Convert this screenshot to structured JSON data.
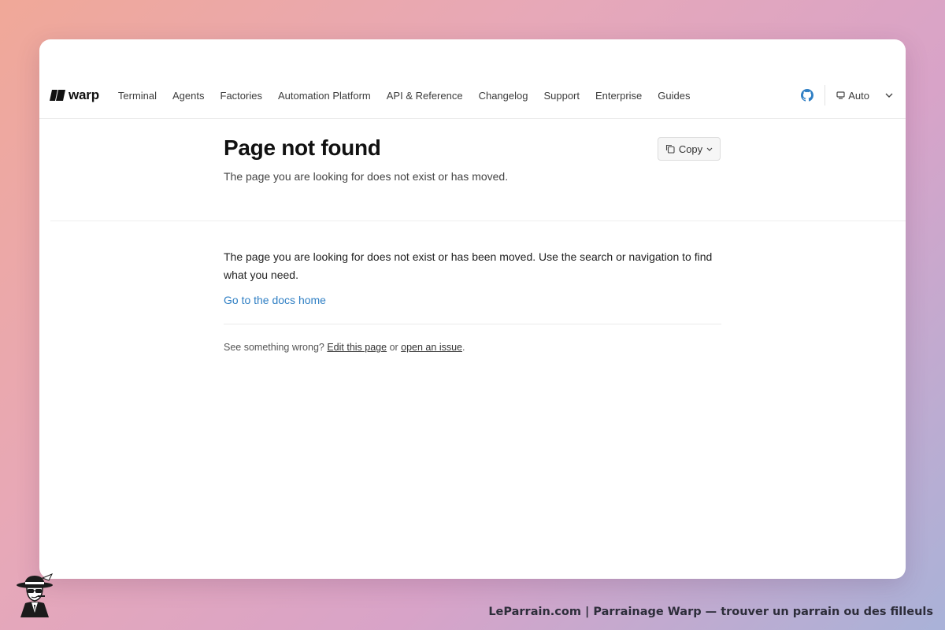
{
  "brand": {
    "logo_text": "warp"
  },
  "nav": {
    "links": [
      "Terminal",
      "Agents",
      "Factories",
      "Automation Platform",
      "API & Reference",
      "Changelog",
      "Support",
      "Enterprise",
      "Guides"
    ],
    "github_icon": "github-icon",
    "theme_icon": "monitor-icon",
    "theme_value": "Auto",
    "theme_chevron_icon": "chevron-down-icon"
  },
  "header": {
    "title": "Page not found",
    "subtitle": "The page you are looking for does not exist or has moved.",
    "copy_label": "Copy",
    "copy_icon": "copy-icon"
  },
  "main": {
    "message": "The page you are looking for does not exist or has been moved. Use the search or navigation to find what you need.",
    "docs_link": "Go to the docs home",
    "feedback_prefix": "See something wrong? ",
    "edit_link": "Edit this page",
    "feedback_or": " or ",
    "issue_link": "open an issue",
    "feedback_suffix": "."
  },
  "caption": {
    "text": "LeParrain.com | Parrainage Warp — trouver un parrain ou des filleuls"
  },
  "colors": {
    "link": "#2f7fc4",
    "github": "#2f7fc4",
    "title": "#111111"
  }
}
